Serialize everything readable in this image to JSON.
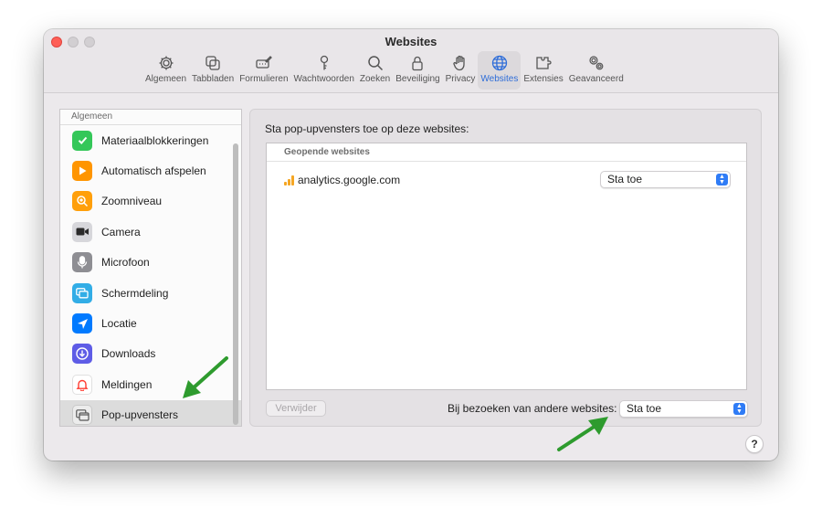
{
  "window": {
    "title": "Websites"
  },
  "toolbar": {
    "items": [
      {
        "label": "Algemeen",
        "icon": "gear-icon"
      },
      {
        "label": "Tabbladen",
        "icon": "tabs-icon"
      },
      {
        "label": "Formulieren",
        "icon": "form-pencil-icon"
      },
      {
        "label": "Wachtwoorden",
        "icon": "key-icon"
      },
      {
        "label": "Zoeken",
        "icon": "magnifier-icon"
      },
      {
        "label": "Beveiliging",
        "icon": "lock-icon"
      },
      {
        "label": "Privacy",
        "icon": "hand-icon"
      },
      {
        "label": "Websites",
        "icon": "globe-icon",
        "active": true
      },
      {
        "label": "Extensies",
        "icon": "puzzle-icon"
      },
      {
        "label": "Geavanceerd",
        "icon": "gears-icon"
      }
    ],
    "accent": "#2e6dd8"
  },
  "sidebar": {
    "header": "Algemeen",
    "items": [
      {
        "label": "Materiaalblokkeringen",
        "icon": "checkmark-shield-icon",
        "color": "#34c759"
      },
      {
        "label": "Automatisch afspelen",
        "icon": "play-icon",
        "color": "#ff9500"
      },
      {
        "label": "Zoomniveau",
        "icon": "zoom-icon",
        "color": "#ff9f0a"
      },
      {
        "label": "Camera",
        "icon": "camera-icon",
        "color": "#8e8e93"
      },
      {
        "label": "Microfoon",
        "icon": "microphone-icon",
        "color": "#8e8e93"
      },
      {
        "label": "Schermdeling",
        "icon": "screen-share-icon",
        "color": "#32ade6"
      },
      {
        "label": "Locatie",
        "icon": "location-arrow-icon",
        "color": "#007aff"
      },
      {
        "label": "Downloads",
        "icon": "download-arrow-icon",
        "color": "#5e5ce6"
      },
      {
        "label": "Meldingen",
        "icon": "bell-icon",
        "color": "#ff3b30"
      },
      {
        "label": "Pop-upvensters",
        "icon": "popup-window-icon",
        "color": "#8e8e93",
        "selected": true
      }
    ]
  },
  "panel": {
    "title": "Sta pop-upvensters toe op deze websites:",
    "table_header": "Geopende websites",
    "rows": [
      {
        "site": "analytics.google.com",
        "setting": "Sta toe"
      }
    ],
    "remove_label": "Verwijder",
    "other_label": "Bij bezoeken van andere websites:",
    "other_value": "Sta toe"
  },
  "help": {
    "label": "?"
  },
  "annotation": {
    "arrow_color": "#2e9b2e"
  }
}
